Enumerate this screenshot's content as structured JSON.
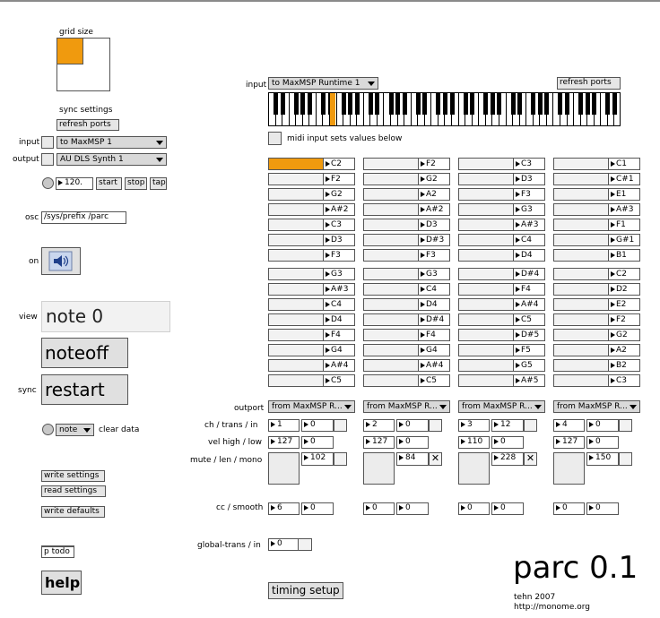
{
  "left": {
    "grid_size_label": "grid size",
    "sync_settings_label": "sync settings",
    "refresh_ports": "refresh ports",
    "input_label": "input",
    "input_device": "to MaxMSP 1",
    "output_label": "output",
    "output_device": "AU DLS Synth 1",
    "tempo": "120.",
    "start": "start",
    "stop": "stop",
    "tap": "tap",
    "osc_label": "osc",
    "osc_prefix": "/sys/prefix /parc",
    "on_label": "on",
    "view_label": "view",
    "view_value": "note 0",
    "noteoff": "noteoff",
    "sync_label": "sync",
    "restart": "restart",
    "clear_menu": "note",
    "clear_data": "clear data",
    "write_settings": "write settings",
    "read_settings": "read settings",
    "write_defaults": "write defaults",
    "p_todo": "p todo",
    "help": "help"
  },
  "midi": {
    "input_label": "input",
    "input_port": "to MaxMSP Runtime 1",
    "refresh_ports": "refresh ports",
    "midi_input_sets": "midi input sets values below"
  },
  "columns": [
    {
      "notes": [
        "C2",
        "F2",
        "G2",
        "A#2",
        "C3",
        "D3",
        "F3",
        "G3",
        "A#3",
        "C4",
        "D4",
        "F4",
        "G4",
        "A#4",
        "C5"
      ],
      "outport": "from MaxMSP R...",
      "ch": "1",
      "trans": "0",
      "vel_high": "127",
      "vel_low": "0",
      "len": "102",
      "mono_x": "",
      "cc": "6",
      "smooth": "0"
    },
    {
      "notes": [
        "F2",
        "G2",
        "A2",
        "A#2",
        "D3",
        "D#3",
        "F3",
        "G3",
        "C4",
        "D4",
        "D#4",
        "F4",
        "G4",
        "A#4",
        "C5"
      ],
      "outport": "from MaxMSP R...",
      "ch": "2",
      "trans": "0",
      "vel_high": "127",
      "vel_low": "0",
      "len": "84",
      "mono_x": "✕",
      "cc": "0",
      "smooth": "0"
    },
    {
      "notes": [
        "C3",
        "D3",
        "F3",
        "G3",
        "A#3",
        "C4",
        "D4",
        "D#4",
        "F4",
        "A#4",
        "C5",
        "D#5",
        "F5",
        "G5",
        "A#5"
      ],
      "outport": "from MaxMSP R...",
      "ch": "3",
      "trans": "12",
      "vel_high": "110",
      "vel_low": "0",
      "len": "228",
      "mono_x": "✕",
      "cc": "0",
      "smooth": "0"
    },
    {
      "notes": [
        "C1",
        "C#1",
        "E1",
        "A#3",
        "F1",
        "G#1",
        "B1",
        "C2",
        "D2",
        "E2",
        "F2",
        "G2",
        "A2",
        "B2",
        "C3"
      ],
      "outport": "from MaxMSP R...",
      "ch": "4",
      "trans": "0",
      "vel_high": "127",
      "vel_low": "0",
      "len": "150",
      "mono_x": "",
      "cc": "0",
      "smooth": "0"
    }
  ],
  "row_labels": {
    "outport": "outport",
    "ch_trans_in": "ch / trans / in",
    "vel": "vel high / low",
    "mute": "mute / len / mono",
    "cc": "cc / smooth",
    "global": "global-trans / in"
  },
  "global_trans": "0",
  "timing_setup": "timing setup",
  "footer": {
    "title": "parc 0.1",
    "author": "tehn 2007",
    "url": "http://monome.org"
  }
}
